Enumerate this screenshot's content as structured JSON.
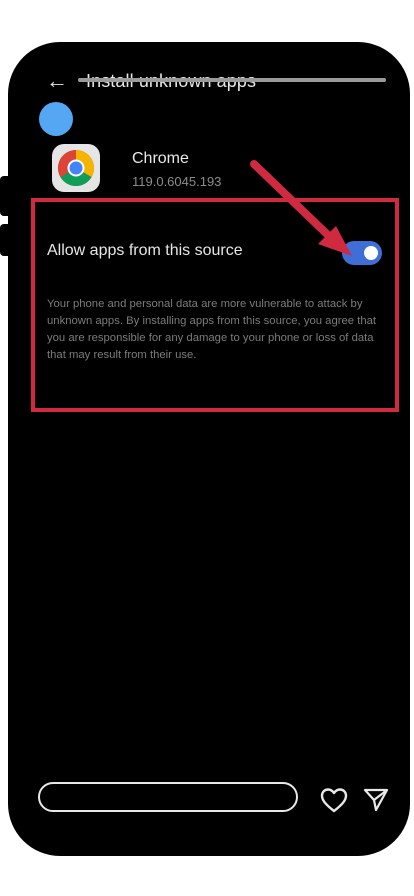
{
  "header": {
    "title": "Install unknown apps",
    "back_icon": "←"
  },
  "app": {
    "name": "Chrome",
    "version": "119.0.6045.193"
  },
  "setting": {
    "label": "Allow apps from this source",
    "enabled": true,
    "warning": "Your phone and personal data are more vulnerable to attack by unknown apps. By installing apps from this source, you agree that you are responsible for any damage to your phone or loss of data that may result from their use."
  },
  "colors": {
    "highlight": "#cf2a3f",
    "toggle_on": "#3f6ed6",
    "dot": "#55a7f4"
  }
}
